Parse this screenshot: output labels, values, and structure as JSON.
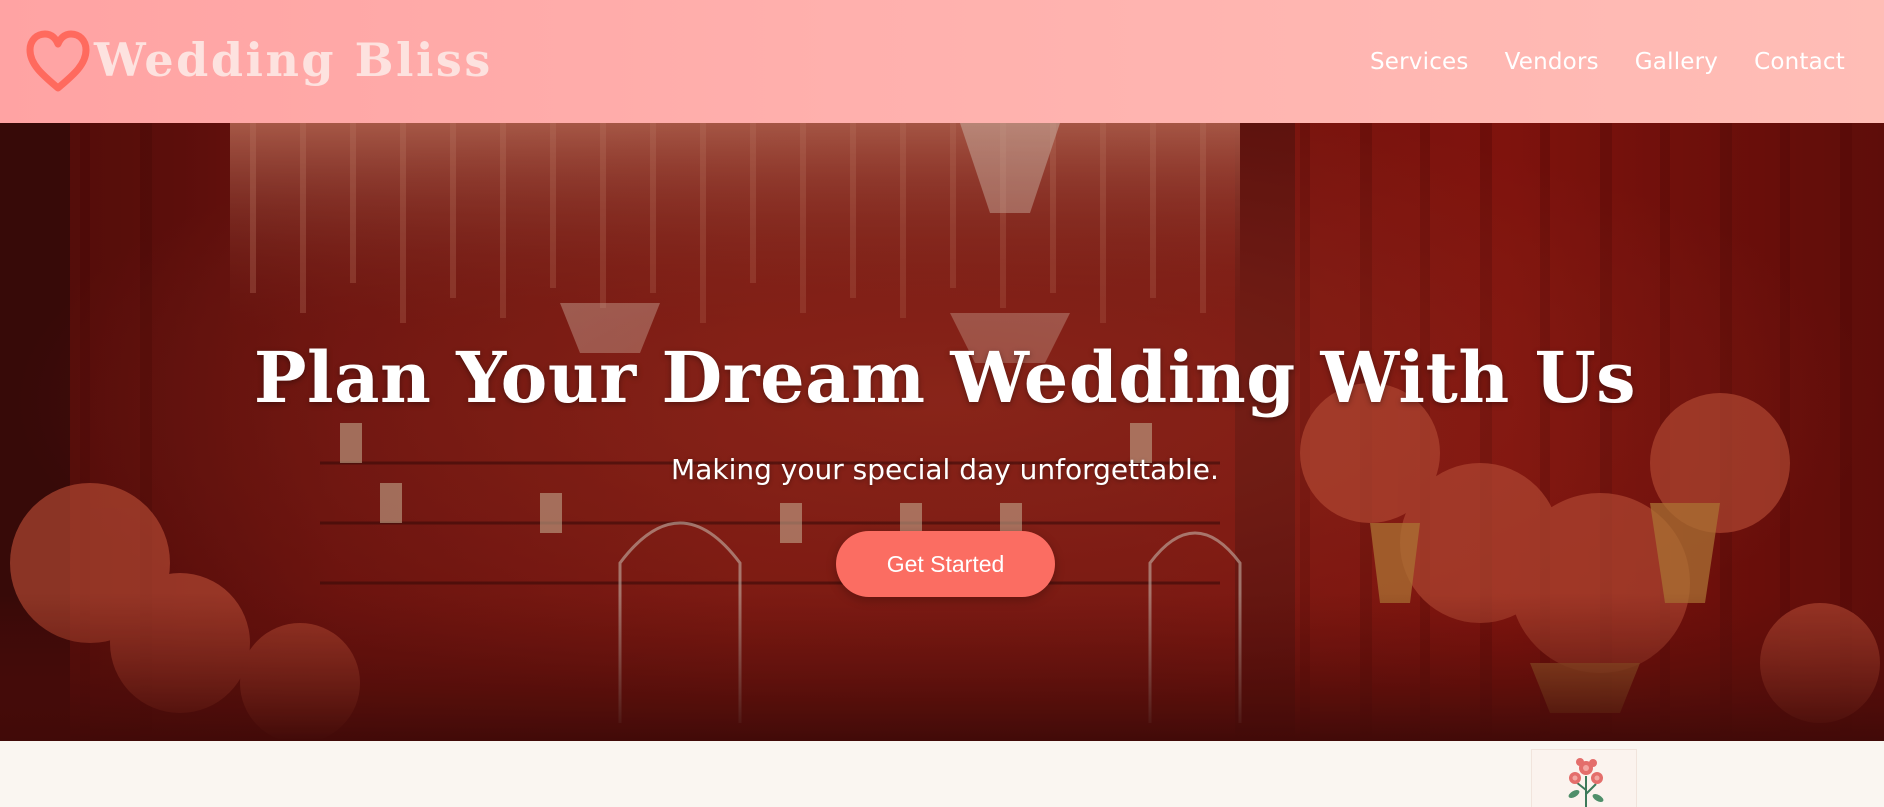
{
  "header": {
    "brand_name": "Wedding Bliss",
    "logo_icon": "heart-icon",
    "nav": [
      {
        "label": "Services"
      },
      {
        "label": "Vendors"
      },
      {
        "label": "Gallery"
      },
      {
        "label": "Contact"
      }
    ]
  },
  "hero": {
    "title": "Plan Your Dream Wedding With Us",
    "subtitle": "Making your special day unforgettable.",
    "cta_label": "Get Started",
    "background": "wedding-venue-photo"
  },
  "colors": {
    "header_gradient_start": "#ffa3a3",
    "header_gradient_end": "#ffbdb6",
    "accent": "#fb6d62",
    "page_background": "#faf6f1"
  }
}
